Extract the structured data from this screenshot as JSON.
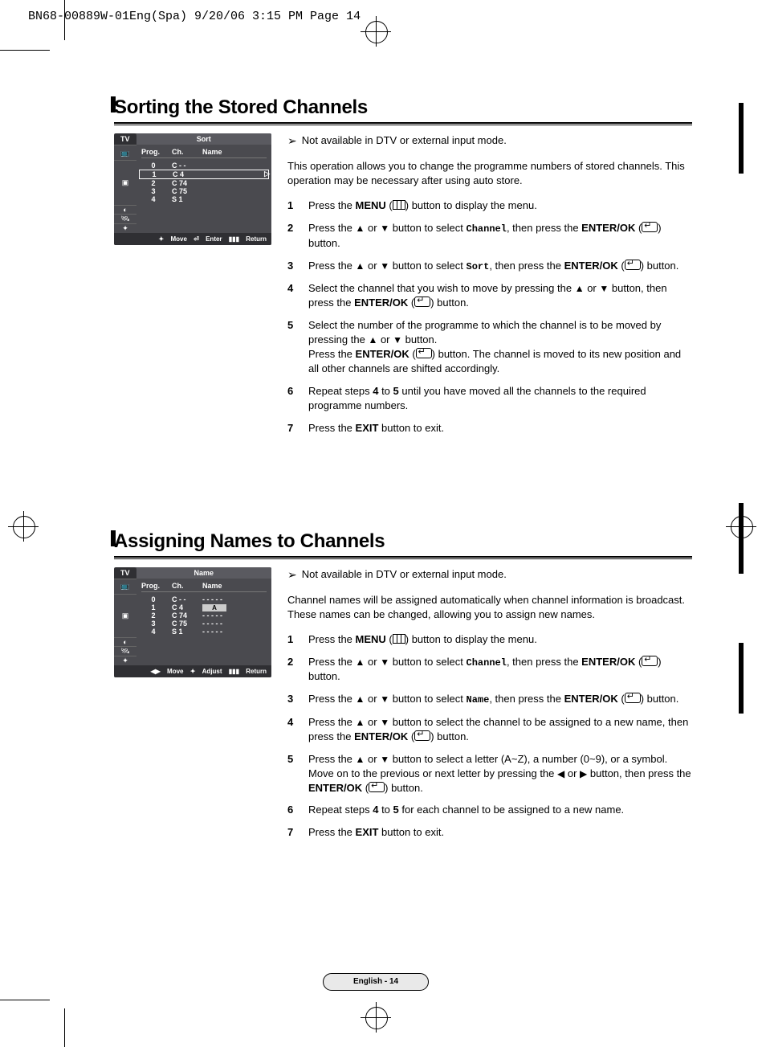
{
  "printHeader": "BN68-00889W-01Eng(Spa)  9/20/06  3:15 PM  Page 14",
  "footer": "English - 14",
  "section1": {
    "title": "Sorting the Stored Channels",
    "note": "Not available in DTV or external input mode.",
    "intro": "This operation allows you to change the programme numbers of stored channels. This operation may be necessary after using auto store.",
    "osd": {
      "tab": "TV",
      "title": "Sort",
      "headers": [
        "Prog.",
        "Ch.",
        "Name"
      ],
      "rows": [
        {
          "prog": "0",
          "ch": "C - -",
          "name": ""
        },
        {
          "prog": "1",
          "ch": "C 4",
          "name": "",
          "selected": true
        },
        {
          "prog": "2",
          "ch": "C 74",
          "name": ""
        },
        {
          "prog": "3",
          "ch": "C 75",
          "name": ""
        },
        {
          "prog": "4",
          "ch": "S 1",
          "name": ""
        }
      ],
      "foot": {
        "move": "Move",
        "enter": "Enter",
        "return": "Return"
      }
    },
    "steps": [
      {
        "n": "1",
        "pre": "Press the ",
        "b1": "MENU",
        "post1": " (",
        "icon": "menu",
        "post2": ") button to display the menu."
      },
      {
        "n": "2",
        "pre": "Press the ",
        "arr1": "▲",
        "mid1": " or ",
        "arr2": "▼",
        "mid2": " button to select ",
        "mono": "Channel",
        "mid3": ", then press the ",
        "b1": "ENTER/OK",
        "post1": " (",
        "icon": "enter",
        "post2": ") button."
      },
      {
        "n": "3",
        "pre": "Press the ",
        "arr1": "▲",
        "mid1": " or ",
        "arr2": "▼",
        "mid2": " button to select ",
        "mono": "Sort",
        "mid3": ", then press the ",
        "b1": "ENTER/OK",
        "post1": " (",
        "icon": "enter",
        "post2": ") button."
      },
      {
        "n": "4",
        "pre": "Select the channel that you wish to move by pressing the ",
        "arr1": "▲",
        "mid1": " or ",
        "arr2": "▼",
        "mid2": " button, then press the ",
        "b1": "ENTER/OK",
        "post1": " (",
        "icon": "enter",
        "post2": ") button."
      },
      {
        "n": "5",
        "pre": "Select the number of the programme to which the channel is to be moved by pressing the ",
        "arr1": "▲",
        "mid1": " or ",
        "arr2": "▼",
        "mid2": " button.",
        "br": true,
        "pre2": "Press the ",
        "b1": "ENTER/OK",
        "post1": " (",
        "icon": "enter",
        "post2": ") button. The channel is moved to its new position and all other channels are shifted accordingly."
      },
      {
        "n": "6",
        "pre": "Repeat steps ",
        "b1": "4",
        "mid1": " to ",
        "b2": "5",
        "post": " until you have moved all the channels to the required programme numbers."
      },
      {
        "n": "7",
        "pre": "Press the ",
        "b1": "EXIT",
        "post": " button to exit."
      }
    ]
  },
  "section2": {
    "title": "Assigning Names to Channels",
    "note": "Not available in DTV or external input mode.",
    "intro": "Channel names will be assigned automatically when channel information is broadcast. These names can be changed, allowing you to assign new names.",
    "osd": {
      "tab": "TV",
      "title": "Name",
      "headers": [
        "Prog.",
        "Ch.",
        "Name"
      ],
      "rows": [
        {
          "prog": "0",
          "ch": "C - -",
          "name": "- - - - -"
        },
        {
          "prog": "1",
          "ch": "C 4",
          "name": "",
          "cursor": "A"
        },
        {
          "prog": "2",
          "ch": "C 74",
          "name": "- - - - -"
        },
        {
          "prog": "3",
          "ch": "C 75",
          "name": "- - - - -"
        },
        {
          "prog": "4",
          "ch": "S 1",
          "name": "- - - - -"
        }
      ],
      "foot": {
        "move": "Move",
        "adjust": "Adjust",
        "return": "Return"
      }
    },
    "steps": [
      {
        "n": "1",
        "pre": "Press the ",
        "b1": "MENU",
        "post1": " (",
        "icon": "menu",
        "post2": ") button to display the menu."
      },
      {
        "n": "2",
        "pre": "Press the ",
        "arr1": "▲",
        "mid1": " or ",
        "arr2": "▼",
        "mid2": " button to select ",
        "mono": "Channel",
        "mid3": ", then press the ",
        "b1": "ENTER/OK",
        "post1": " (",
        "icon": "enter",
        "post2": ") button."
      },
      {
        "n": "3",
        "pre": "Press the ",
        "arr1": "▲",
        "mid1": " or ",
        "arr2": "▼",
        "mid2": " button to select ",
        "mono": "Name",
        "mid3": ", then press the ",
        "b1": "ENTER/OK",
        "post1": " (",
        "icon": "enter",
        "post2": ") button."
      },
      {
        "n": "4",
        "pre": "Press the ",
        "arr1": "▲",
        "mid1": " or ",
        "arr2": "▼",
        "mid2": " button to select the channel to be assigned to a new name, then press the ",
        "b1": "ENTER/OK",
        "post1": " (",
        "icon": "enter",
        "post2": ") button."
      },
      {
        "n": "5",
        "pre": "Press the ",
        "arr1": "▲",
        "mid1": " or ",
        "arr2": "▼",
        "mid2": " button to select a letter (A~Z), a number (0~9), or a symbol. Move on to the previous or next letter by pressing the ",
        "arr3": "◀",
        "mid3": " or ",
        "arr4": "▶",
        "mid4": " button, then press the ",
        "b1": "ENTER/OK",
        "post1": " (",
        "icon": "enter",
        "post2": ") button."
      },
      {
        "n": "6",
        "pre": "Repeat steps ",
        "b1": "4",
        "mid1": " to ",
        "b2": "5",
        "post": " for each channel to be assigned to a new name."
      },
      {
        "n": "7",
        "pre": "Press the ",
        "b1": "EXIT",
        "post": " button to exit."
      }
    ]
  }
}
